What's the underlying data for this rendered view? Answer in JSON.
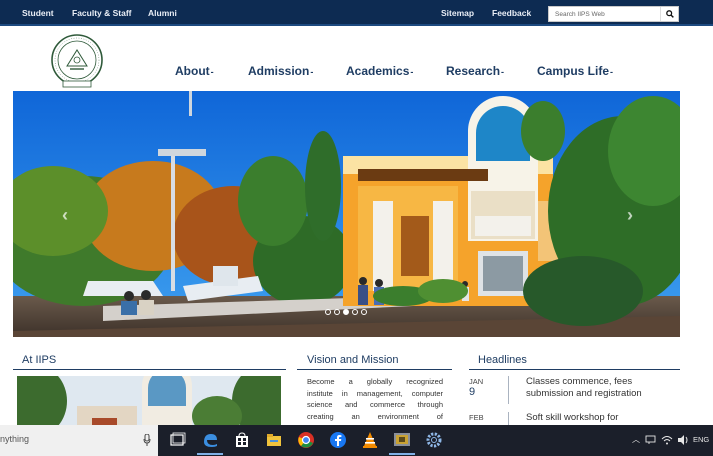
{
  "topbar": {
    "links": [
      "Student",
      "Faculty & Staff",
      "Alumni"
    ],
    "sitemap": "Sitemap",
    "feedback": "Feedback",
    "search_placeholder": "Search IIPS Web"
  },
  "nav": {
    "items": [
      {
        "label": "About"
      },
      {
        "label": "Admission"
      },
      {
        "label": "Academics"
      },
      {
        "label": "Research"
      },
      {
        "label": "Campus Life"
      }
    ],
    "caret": "-"
  },
  "slider": {
    "slide_count": 5,
    "active_index": 2
  },
  "sections": {
    "at_iips": {
      "title": "At IIPS"
    },
    "vision": {
      "title": "Vision and Mission",
      "lines": [
        "Become a globally recognized",
        "institute in management, computer",
        "science and commerce through",
        "creating an environment of"
      ]
    },
    "headlines": {
      "title": "Headlines",
      "items": [
        {
          "month": "JAN",
          "day": "9",
          "lines": [
            "Classes commence, fees",
            "submission and registration"
          ]
        },
        {
          "month": "FEB",
          "day": "",
          "lines": [
            "Soft skill workshop for"
          ]
        }
      ]
    }
  },
  "taskbar": {
    "search_text": "nything",
    "apps": [
      "task-view",
      "edge",
      "store",
      "file-explorer",
      "chrome",
      "facebook",
      "vlc",
      "app",
      "settings"
    ],
    "language": "ENG"
  },
  "colors": {
    "topbar": "#0d2b52",
    "nav_text": "#1f3d63",
    "taskbar": "#1b1f2a"
  }
}
